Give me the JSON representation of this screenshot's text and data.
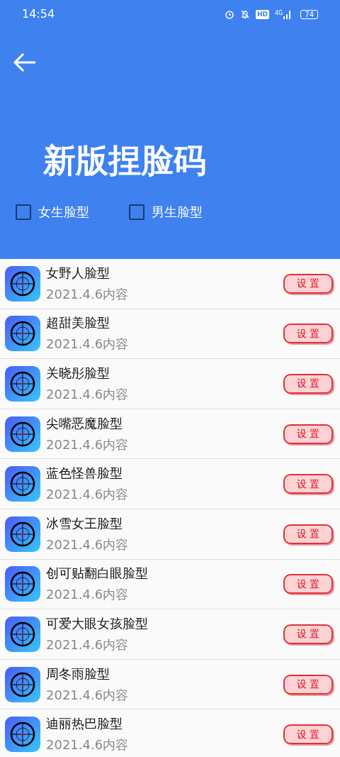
{
  "status_bar": {
    "time": "14:54",
    "hd": "HD",
    "network": "4G",
    "battery": "74"
  },
  "header": {
    "title": "新版捏脸码"
  },
  "filters": [
    {
      "label": "女生脸型",
      "checked": false
    },
    {
      "label": "男生脸型",
      "checked": false
    }
  ],
  "items": [
    {
      "title": "女野人脸型",
      "subtitle": "2021.4.6内容",
      "action": "设 置"
    },
    {
      "title": "超甜美脸型",
      "subtitle": "2021.4.6内容",
      "action": "设 置"
    },
    {
      "title": "关晓彤脸型",
      "subtitle": "2021.4.6内容",
      "action": "设 置"
    },
    {
      "title": "尖嘴恶魔脸型",
      "subtitle": "2021.4.6内容",
      "action": "设 置"
    },
    {
      "title": "蓝色怪兽脸型",
      "subtitle": "2021.4.6内容",
      "action": "设 置"
    },
    {
      "title": "冰雪女王脸型",
      "subtitle": "2021.4.6内容",
      "action": "设 置"
    },
    {
      "title": "创可贴翻白眼脸型",
      "subtitle": "2021.4.6内容",
      "action": "设 置"
    },
    {
      "title": "可爱大眼女孩脸型",
      "subtitle": "2021.4.6内容",
      "action": "设 置"
    },
    {
      "title": "周冬雨脸型",
      "subtitle": "2021.4.6内容",
      "action": "设 置"
    },
    {
      "title": "迪丽热巴脸型",
      "subtitle": "2021.4.6内容",
      "action": "设 置"
    }
  ]
}
